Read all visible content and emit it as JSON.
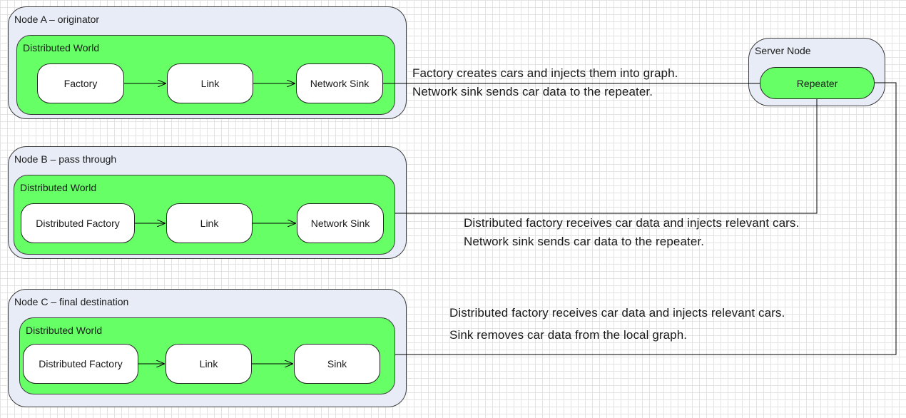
{
  "nodes": {
    "a": {
      "title": "Node A – originator",
      "world": "Distributed World",
      "components": [
        "Factory",
        "Link",
        "Network Sink"
      ]
    },
    "b": {
      "title": "Node B – pass through",
      "world": "Distributed World",
      "components": [
        "Distributed Factory",
        "Link",
        "Network Sink"
      ]
    },
    "c": {
      "title": "Node C – final destination",
      "world": "Distributed World",
      "components": [
        "Distributed Factory",
        "Link",
        "Sink"
      ]
    },
    "server": {
      "title": "Server Node",
      "component": "Repeater"
    }
  },
  "notes": {
    "a": [
      "Factory creates cars and injects them into graph.",
      "Network sink sends car data to the repeater."
    ],
    "b": [
      "Distributed factory receives car data and injects relevant cars.",
      "Network sink sends car data to the repeater."
    ],
    "c": [
      "Distributed factory receives car data and injects relevant cars.",
      "Sink removes car data from the local graph."
    ]
  },
  "colors": {
    "node_fill": "#e8ecf6",
    "world_fill": "#66ff66",
    "component_fill": "#ffffff",
    "line": "#000000"
  }
}
